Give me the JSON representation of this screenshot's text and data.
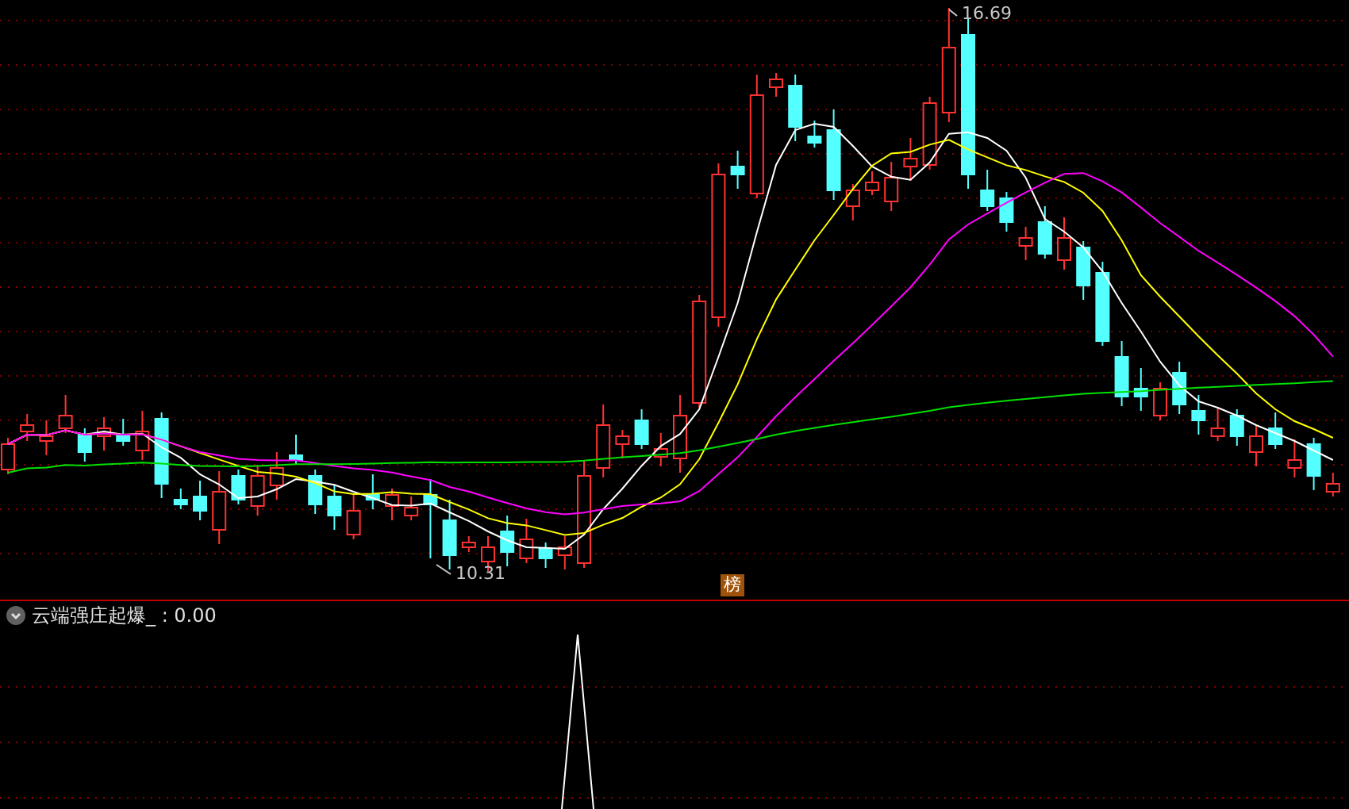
{
  "price_chart": {
    "high_label": "16.69",
    "low_label": "10.31",
    "badge": "榜"
  },
  "indicator": {
    "title": "云端强庄起爆_ : 0.00"
  }
}
